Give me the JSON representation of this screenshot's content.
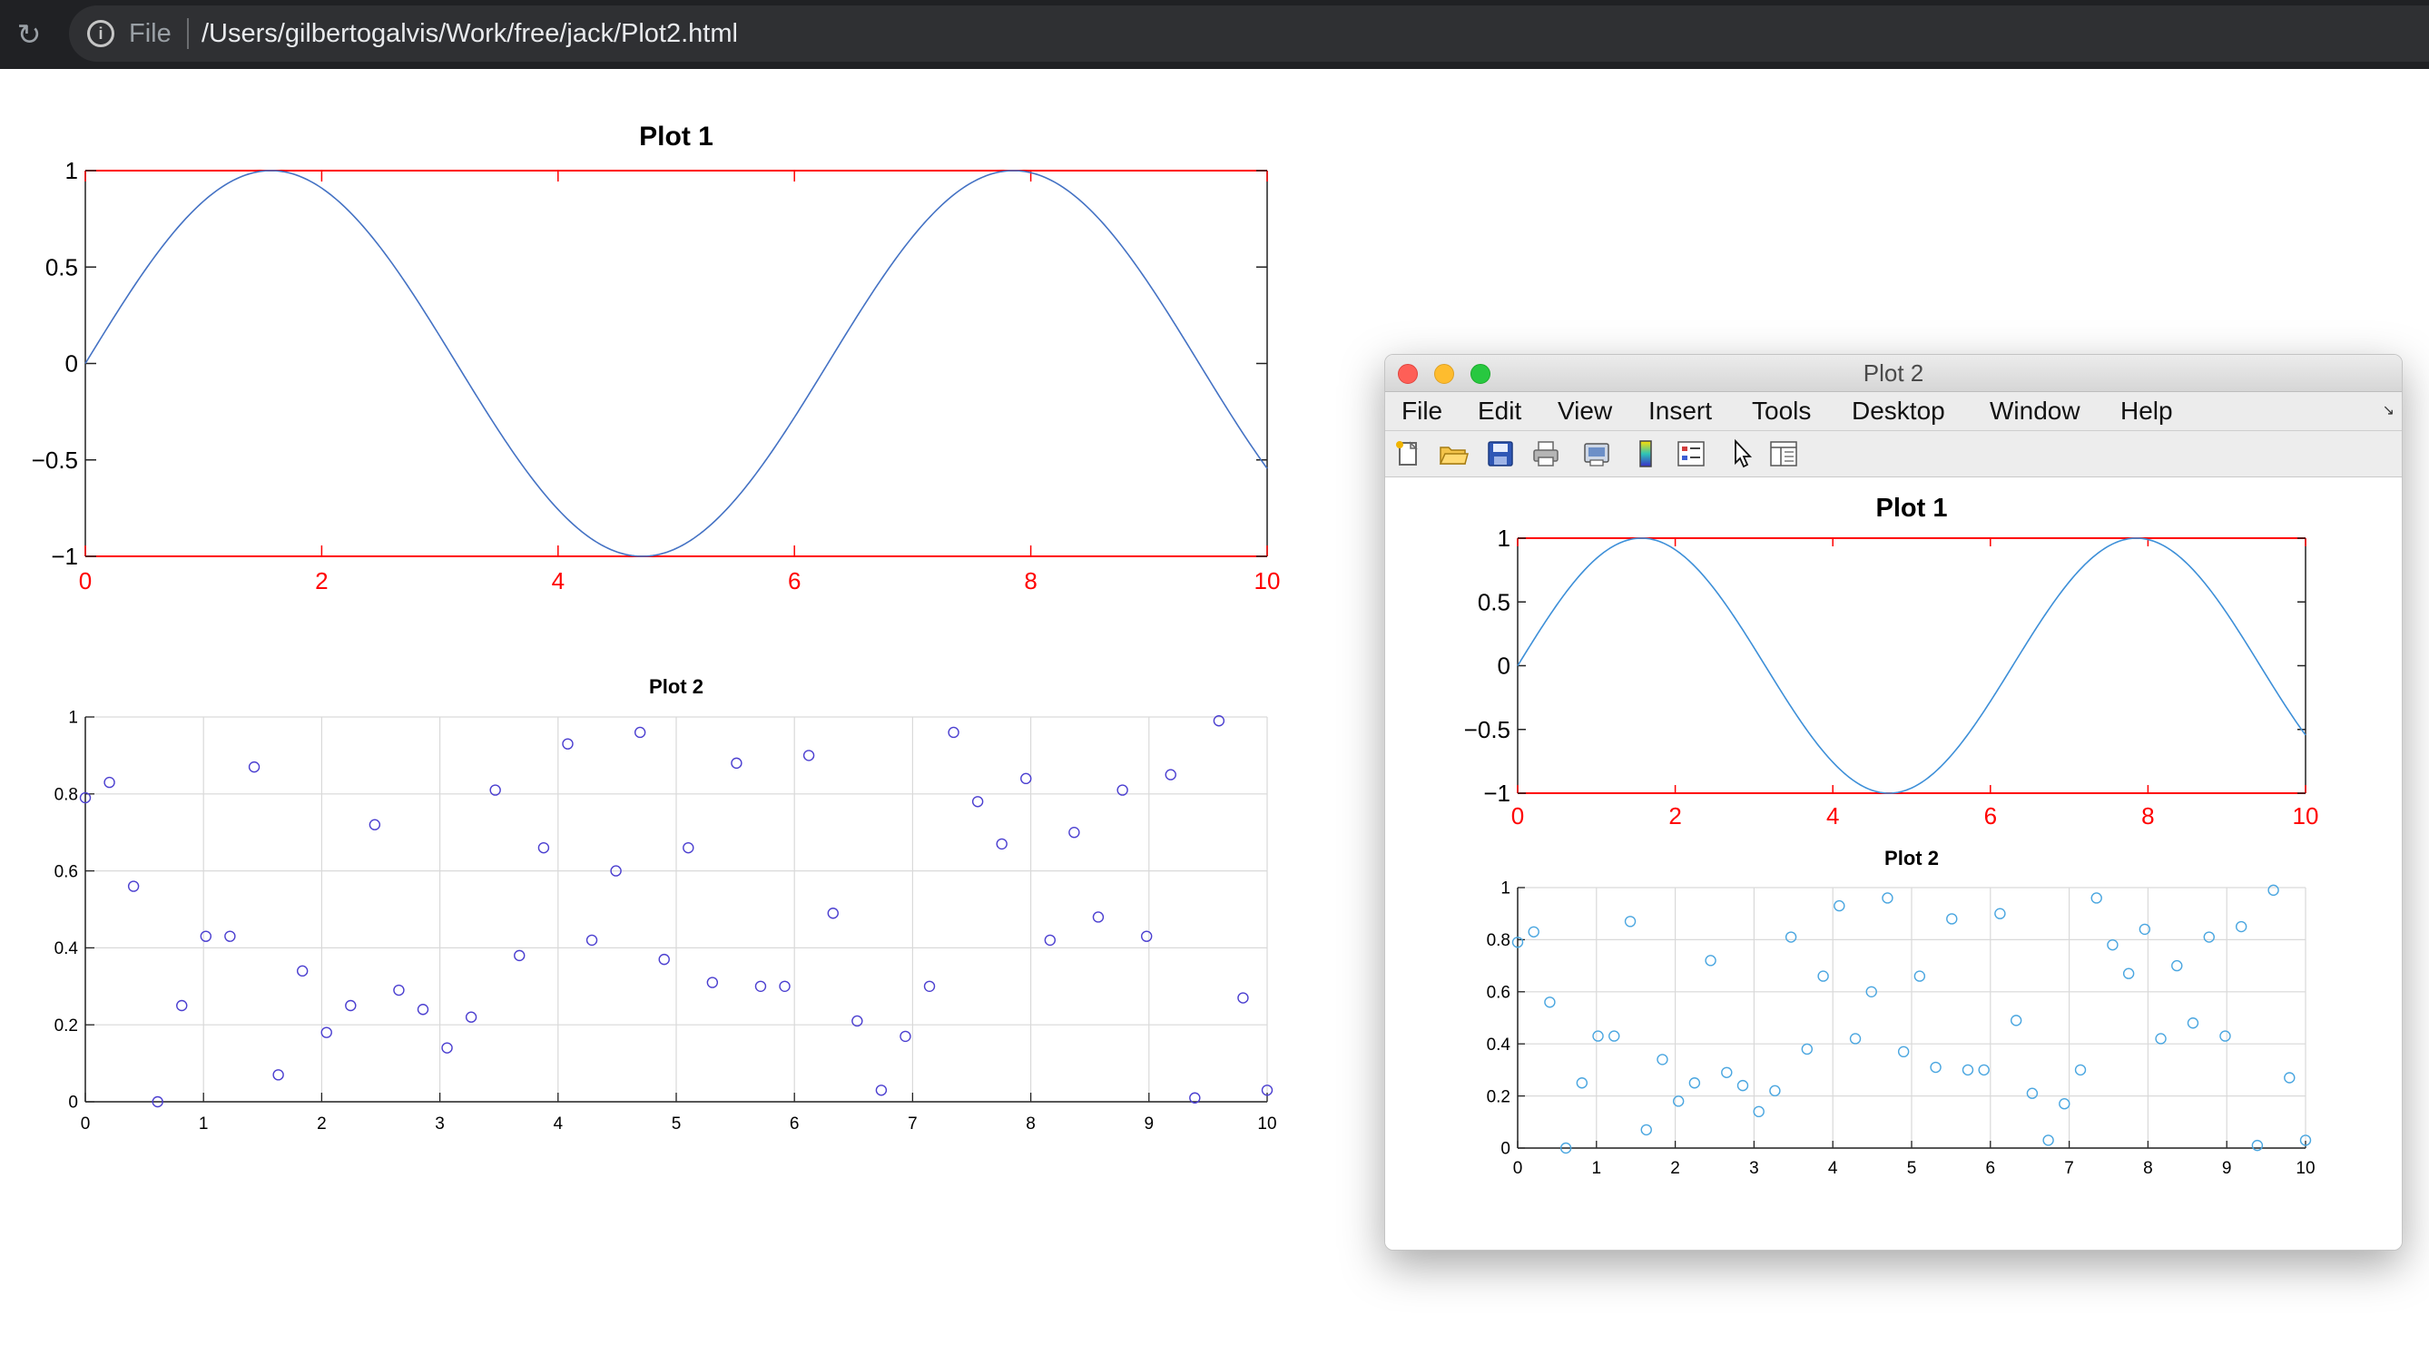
{
  "browser": {
    "scheme": "File",
    "url": "/Users/gilbertogalvis/Work/free/jack/Plot2.html"
  },
  "matlab_window": {
    "title": "Plot 2",
    "menu": [
      "File",
      "Edit",
      "View",
      "Insert",
      "Tools",
      "Desktop",
      "Window",
      "Help"
    ],
    "toolbar_icons": [
      "new-figure-icon",
      "open-file-icon",
      "save-icon",
      "print-icon",
      "print-preview-icon",
      "colorbar-icon",
      "legend-icon",
      "pointer-icon",
      "property-editor-icon"
    ]
  },
  "chart_data": [
    {
      "type": "line",
      "title": "Plot 1",
      "function": "sin(x)",
      "x_range": [
        0,
        10
      ],
      "xlim": [
        0,
        10
      ],
      "ylim": [
        -1,
        1
      ],
      "xticks": [
        "0",
        "2",
        "4",
        "6",
        "8",
        "10"
      ],
      "yticks": [
        "1",
        "0.5",
        "0",
        "−0.5",
        "−1"
      ],
      "ytick_values": [
        1,
        0.5,
        0,
        -0.5,
        -1
      ],
      "xtick_values": [
        0,
        2,
        4,
        6,
        8,
        10
      ],
      "line_color": "#4472c4",
      "axis_color": "#ff0000",
      "grid": false
    },
    {
      "type": "scatter",
      "title": "Plot 2",
      "xlim": [
        0,
        10
      ],
      "ylim": [
        0,
        1
      ],
      "xticks": [
        "0",
        "1",
        "2",
        "3",
        "4",
        "5",
        "6",
        "7",
        "8",
        "9",
        "10"
      ],
      "xtick_values": [
        0,
        1,
        2,
        3,
        4,
        5,
        6,
        7,
        8,
        9,
        10
      ],
      "yticks": [
        "0",
        "0.2",
        "0.4",
        "0.6",
        "0.8",
        "1"
      ],
      "ytick_values": [
        0,
        0.2,
        0.4,
        0.6,
        0.8,
        1
      ],
      "marker": "circle",
      "marker_color": "#4b3fd0",
      "grid": true,
      "x": [
        0,
        0.204,
        0.408,
        0.612,
        0.816,
        1.02,
        1.224,
        1.429,
        1.633,
        1.837,
        2.041,
        2.245,
        2.449,
        2.653,
        2.857,
        3.061,
        3.265,
        3.469,
        3.673,
        3.878,
        4.082,
        4.286,
        4.49,
        4.694,
        4.898,
        5.102,
        5.306,
        5.51,
        5.714,
        5.918,
        6.122,
        6.327,
        6.531,
        6.735,
        6.939,
        7.143,
        7.347,
        7.551,
        7.755,
        7.959,
        8.163,
        8.367,
        8.571,
        8.776,
        8.98,
        9.184,
        9.388,
        9.592,
        9.796,
        10
      ],
      "y": [
        0.79,
        0.83,
        0.56,
        0.0,
        0.25,
        0.43,
        0.43,
        0.87,
        0.07,
        0.34,
        0.18,
        0.25,
        0.72,
        0.29,
        0.24,
        0.14,
        0.22,
        0.81,
        0.38,
        0.66,
        0.93,
        0.42,
        0.6,
        0.96,
        0.37,
        0.66,
        0.31,
        0.88,
        0.3,
        0.3,
        0.9,
        0.49,
        0.21,
        0.03,
        0.17,
        0.3,
        0.96,
        0.78,
        0.67,
        0.84,
        0.42,
        0.7,
        0.48,
        0.81,
        0.43,
        0.85,
        0.01,
        0.99,
        0.27,
        0.03
      ]
    }
  ],
  "figure_colors": {
    "embedded_marker": "#4b3fd0",
    "window_marker": "#4aa6e0",
    "window_line": "#3d8fd8",
    "grid": "#d9d9d9"
  }
}
